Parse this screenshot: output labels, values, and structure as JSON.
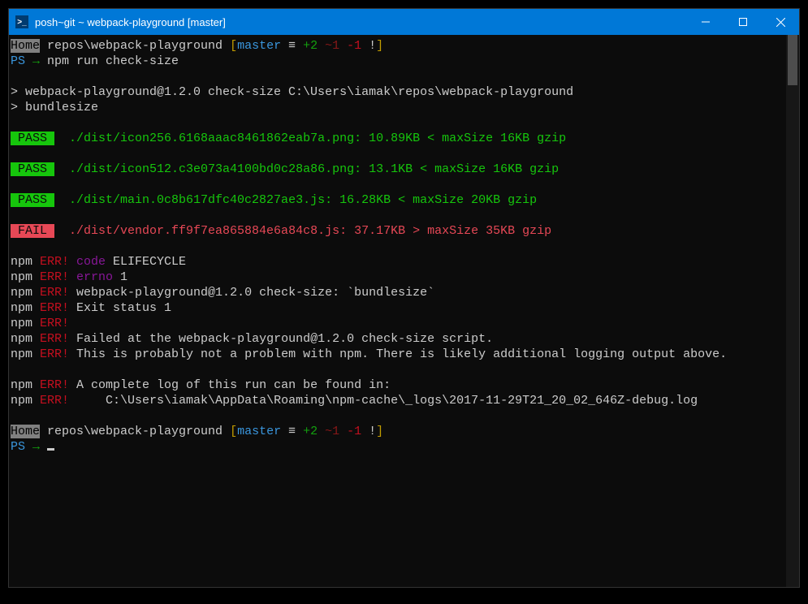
{
  "title": "posh~git ~ webpack-playground [master]",
  "prompt1": {
    "home": "Home",
    "path": " repos\\webpack-playground ",
    "branch_open": "[",
    "branch": "master",
    "equiv": " ≡ ",
    "plus": "+2",
    "tilde": " ~1",
    "minus": " -1",
    "bang": " !",
    "branch_close": "]"
  },
  "ps": "PS ",
  "arrow": "→ ",
  "command": "npm run check-size",
  "npm_header1": "> webpack-playground@1.2.0 check-size C:\\Users\\iamak\\repos\\webpack-playground",
  "npm_header2": "> bundlesize",
  "pass_label": " PASS ",
  "fail_label": " FAIL ",
  "results": [
    {
      "status": "pass",
      "text": "  ./dist/icon256.6168aaac8461862eab7a.png: 10.89KB < maxSize 16KB gzip"
    },
    {
      "status": "pass",
      "text": "  ./dist/icon512.c3e073a4100bd0c28a86.png: 13.1KB < maxSize 16KB gzip"
    },
    {
      "status": "pass",
      "text": "  ./dist/main.0c8b617dfc40c2827ae3.js: 16.28KB < maxSize 20KB gzip"
    },
    {
      "status": "fail",
      "text": "  ./dist/vendor.ff9f7ea865884e6a84c8.js: 37.17KB > maxSize 35KB gzip"
    }
  ],
  "npm": "npm",
  "err": " ERR!",
  "errs": {
    "e1_code": " code",
    "e1_val": " ELIFECYCLE",
    "e2_errno": " errno",
    "e2_val": " 1",
    "e3": " webpack-playground@1.2.0 check-size: `bundlesize`",
    "e4": " Exit status 1",
    "e6": " Failed at the webpack-playground@1.2.0 check-size script.",
    "e7": " This is probably not a problem with npm. There is likely additional logging output above.",
    "e8": " A complete log of this run can be found in:",
    "e9": "     C:\\Users\\iamak\\AppData\\Roaming\\npm-cache\\_logs\\2017-11-29T21_20_02_646Z-debug.log"
  }
}
